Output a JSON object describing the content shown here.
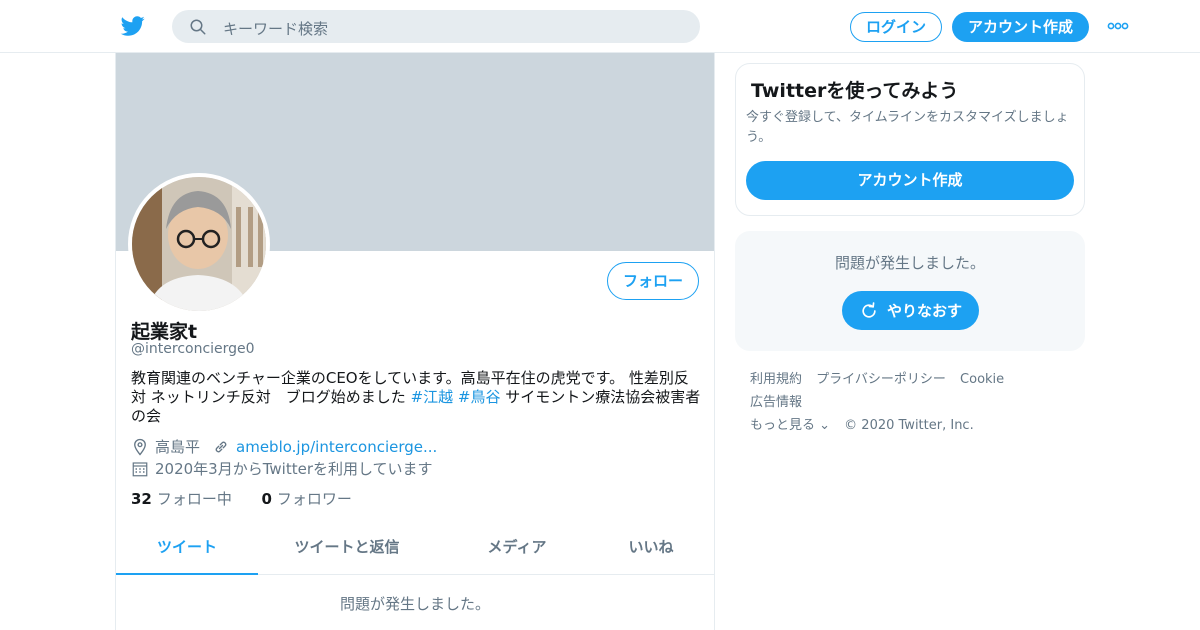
{
  "header": {
    "search_placeholder": "キーワード検索",
    "login_label": "ログイン",
    "signup_label": "アカウント作成",
    "brand_color": "#1da1f2"
  },
  "profile": {
    "display_name": "起業家t",
    "screen_name": "@interconcierge0",
    "follow_label": "フォロー",
    "bio_lines": [
      "教育関連のベンチャー企業のCEOをしています。高島平在住の虎党です。 性差別反",
      "対 ネットリンチ反対　ブログ始めました",
      "サイモントン療法協会被害者",
      "の会"
    ],
    "hashtags": [
      "#江越",
      "#鳥谷"
    ],
    "location": "高島平",
    "url": "ameblo.jp/interconcierge...",
    "joined": "2020年3月からTwitterを利用しています",
    "following_count": "32",
    "following_label": "フォロー中",
    "followers_count": "0",
    "followers_label": "フォロワー"
  },
  "tabs": [
    {
      "label": "ツイート",
      "active": true
    },
    {
      "label": "ツイートと返信",
      "active": false
    },
    {
      "label": "メディア",
      "active": false
    },
    {
      "label": "いいね",
      "active": false
    }
  ],
  "main_error": "問題が発生しました。",
  "sidebar": {
    "signup_card": {
      "title": "Twitterを使ってみよう",
      "subtitle": "今すぐ登録して、タイムラインをカスタマイズしましょう。",
      "button": "アカウント作成"
    },
    "error_card": {
      "message": "問題が発生しました。",
      "retry_label": "やりなおす"
    }
  },
  "footer": {
    "links": [
      "利用規約",
      "プライバシーポリシー",
      "Cookie",
      "広告情報",
      "もっと見る ⌄"
    ],
    "copyright": "© 2020 Twitter, Inc."
  },
  "icons": {
    "logo": "twitter-bird-icon",
    "search": "search-icon",
    "more": "more-dots-icon",
    "location": "location-pin-icon",
    "link": "link-icon",
    "calendar": "calendar-icon",
    "retry": "refresh-icon"
  }
}
